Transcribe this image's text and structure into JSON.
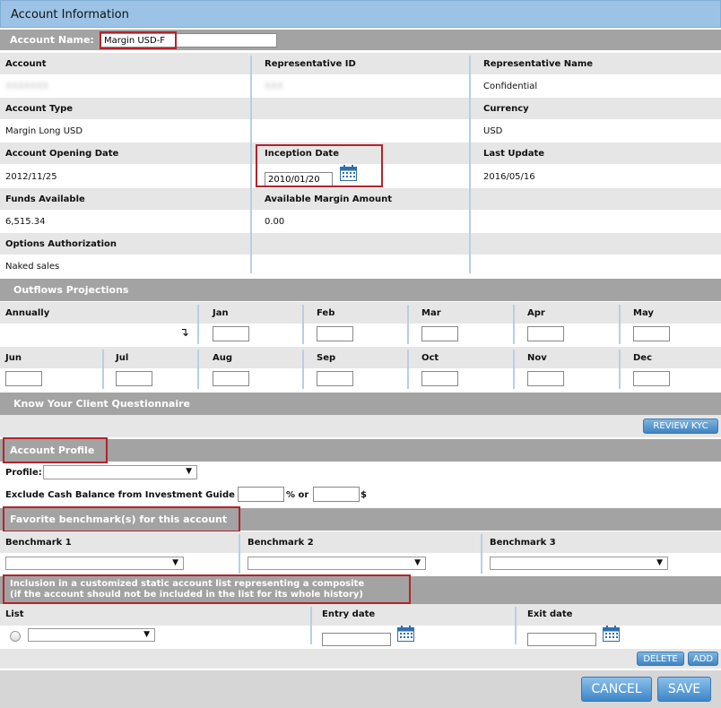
{
  "header": {
    "title": "Account Information"
  },
  "account_name": {
    "label": "Account Name:",
    "value": "Margin USD-F"
  },
  "fields": {
    "account": {
      "label": "Account",
      "value": "XXXXXXX"
    },
    "rep_id": {
      "label": "Representative ID",
      "value": "XXX"
    },
    "rep_name": {
      "label": "Representative Name",
      "value": "Confidential"
    },
    "account_type": {
      "label": "Account Type",
      "value": "Margin Long USD"
    },
    "currency": {
      "label": "Currency",
      "value": "USD"
    },
    "opening_date": {
      "label": "Account Opening Date",
      "value": "2012/11/25"
    },
    "inception_date": {
      "label": "Inception Date",
      "value": "2010/01/20"
    },
    "last_update": {
      "label": "Last Update",
      "value": "2016/05/16"
    },
    "funds_available": {
      "label": "Funds Available",
      "value": "6,515.34"
    },
    "available_margin": {
      "label": "Available Margin Amount",
      "value": "0.00"
    },
    "options_auth": {
      "label": "Options Authorization",
      "value": "Naked sales"
    }
  },
  "outflows": {
    "title": "Outflows Projections",
    "annually": "Annually",
    "row1": [
      "Jan",
      "Feb",
      "Mar",
      "Apr",
      "May"
    ],
    "row2": [
      "Jun",
      "Jul",
      "Aug",
      "Sep",
      "Oct",
      "Nov",
      "Dec"
    ]
  },
  "kyc": {
    "title": "Know Your Client Questionnaire",
    "review_button": "REVIEW KYC"
  },
  "profile": {
    "title": "Account Profile",
    "profile_label": "Profile:",
    "exclude_label": "Exclude Cash Balance from Investment Guide",
    "percent_or": "% or",
    "dollar": "$"
  },
  "benchmarks": {
    "title": "Favorite benchmark(s) for this account",
    "labels": [
      "Benchmark 1",
      "Benchmark 2",
      "Benchmark 3"
    ]
  },
  "inclusion": {
    "title_line1": "Inclusion in a customized static account list representing a composite",
    "title_line2": "(if the account should not be included in the list for its whole history)",
    "list_label": "List",
    "entry_label": "Entry date",
    "exit_label": "Exit date",
    "delete_button": "DELETE",
    "add_button": "ADD"
  },
  "footer": {
    "cancel": "CANCEL",
    "save": "SAVE"
  },
  "colors": {
    "header_blue": "#9cc3e6",
    "section_gray": "#a3a3a3",
    "highlight_red": "#b3242b",
    "button_blue": "#3f84c2"
  }
}
